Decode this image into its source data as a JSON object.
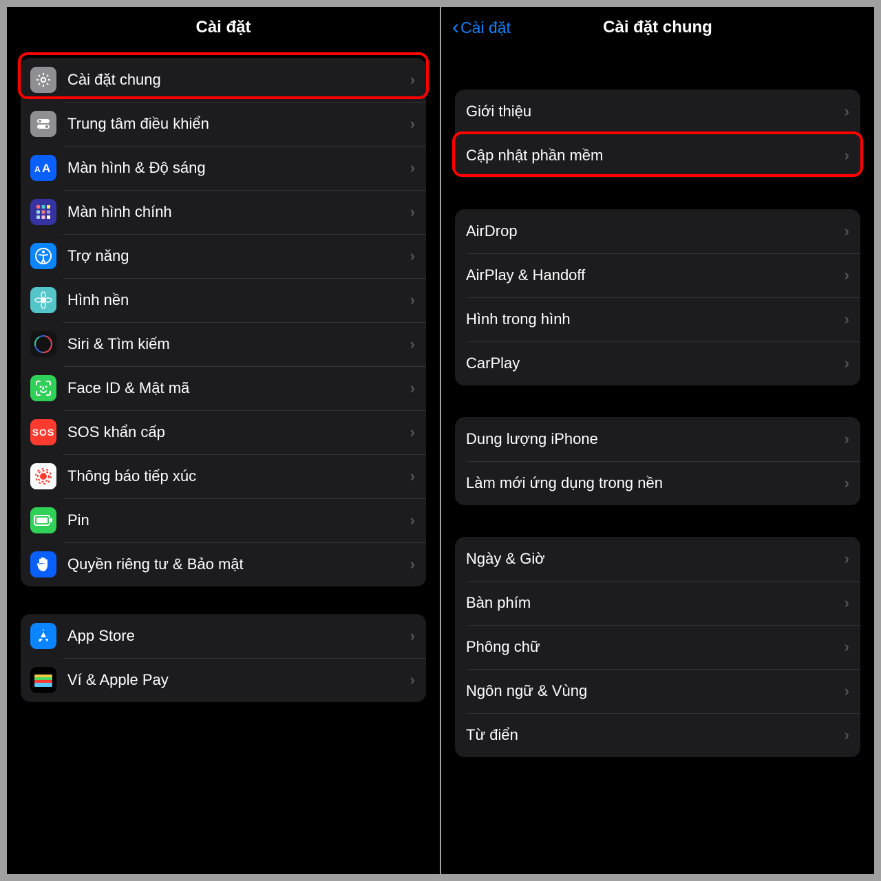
{
  "left": {
    "title": "Cài đặt",
    "group1": [
      {
        "id": "general",
        "label": "Cài đặt chung",
        "highlight": true
      },
      {
        "id": "control-center",
        "label": "Trung tâm điều khiển"
      },
      {
        "id": "display",
        "label": "Màn hình & Độ sáng"
      },
      {
        "id": "home-screen",
        "label": "Màn hình chính"
      },
      {
        "id": "accessibility",
        "label": "Trợ năng"
      },
      {
        "id": "wallpaper",
        "label": "Hình nền"
      },
      {
        "id": "siri",
        "label": "Siri & Tìm kiếm"
      },
      {
        "id": "faceid",
        "label": "Face ID & Mật mã"
      },
      {
        "id": "sos",
        "label": "SOS khẩn cấp"
      },
      {
        "id": "exposure",
        "label": "Thông báo tiếp xúc"
      },
      {
        "id": "battery",
        "label": "Pin"
      },
      {
        "id": "privacy",
        "label": "Quyền riêng tư & Bảo mật"
      }
    ],
    "group2": [
      {
        "id": "appstore",
        "label": "App Store"
      },
      {
        "id": "wallet",
        "label": "Ví & Apple Pay"
      }
    ]
  },
  "right": {
    "back": "Cài đặt",
    "title": "Cài đặt chung",
    "group1": [
      {
        "id": "about",
        "label": "Giới thiệu"
      },
      {
        "id": "software-update",
        "label": "Cập nhật phần mềm",
        "highlight": true
      }
    ],
    "group2": [
      {
        "id": "airdrop",
        "label": "AirDrop"
      },
      {
        "id": "airplay",
        "label": "AirPlay & Handoff"
      },
      {
        "id": "pip",
        "label": "Hình trong hình"
      },
      {
        "id": "carplay",
        "label": "CarPlay"
      }
    ],
    "group3": [
      {
        "id": "storage",
        "label": "Dung lượng iPhone"
      },
      {
        "id": "bg-refresh",
        "label": "Làm mới ứng dụng trong nền"
      }
    ],
    "group4": [
      {
        "id": "datetime",
        "label": "Ngày & Giờ"
      },
      {
        "id": "keyboard",
        "label": "Bàn phím"
      },
      {
        "id": "fonts",
        "label": "Phông chữ"
      },
      {
        "id": "language",
        "label": "Ngôn ngữ & Vùng"
      },
      {
        "id": "dictionary",
        "label": "Từ điển"
      }
    ]
  }
}
